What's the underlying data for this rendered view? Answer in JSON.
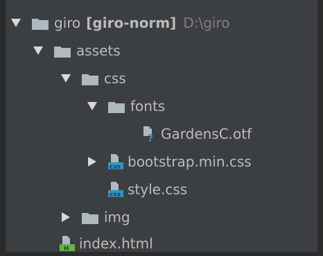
{
  "tree": {
    "root": {
      "name": "giro",
      "module": "[giro-norm]",
      "path": "D:\\giro",
      "expanded": true
    },
    "assets": {
      "name": "assets",
      "expanded": true
    },
    "css": {
      "name": "css",
      "expanded": true
    },
    "fonts": {
      "name": "fonts",
      "expanded": true
    },
    "font_file": {
      "name": "GardensC.otf",
      "icon": "unknown-file-icon"
    },
    "bootstrap": {
      "name": "bootstrap.min.css",
      "icon": "css-file-icon",
      "expanded": false
    },
    "style": {
      "name": "style.css",
      "icon": "css-file-icon"
    },
    "img": {
      "name": "img",
      "expanded": false
    },
    "index": {
      "name": "index.html",
      "icon": "html-file-icon"
    }
  },
  "colors": {
    "background": "#3c3f41",
    "text": "#bbbbbb",
    "dim_text": "#808080",
    "folder": "#aeb9c0",
    "css_badge": "#3592c4",
    "html_badge": "#62b543",
    "unknown_badge": "#3592c4"
  }
}
